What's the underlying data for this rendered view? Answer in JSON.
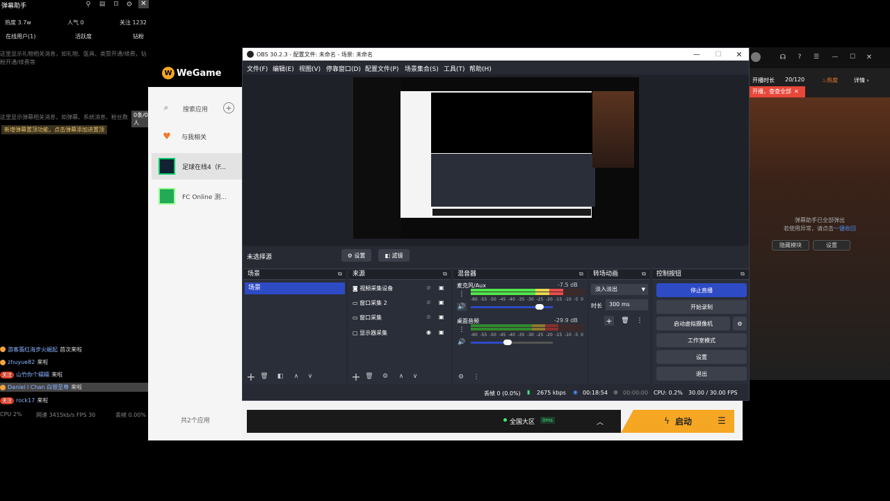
{
  "danmu": {
    "title": "弹幕助手",
    "stats": {
      "heat": "热度 3.7w",
      "popularity": "人气 0",
      "follow": "关注 1232"
    },
    "tabs": [
      "在线用户(1)",
      "活跃度",
      "钻粉"
    ],
    "hint1": "这里显示礼物相关消息，如礼物、医具、类赞开通/续费，钻粉开通/续费等",
    "hint2": "这里显示弹幕相关消息，如弹幕、系统消息、粉丝数",
    "badge": "0条/0人",
    "notice": "新增弹幕置顶功能，点击弹幕添加进置顶",
    "messages": [
      {
        "tag": "",
        "user": "游客翡红海步火崛起",
        "text": "首次来啦"
      },
      {
        "tag": "",
        "user": "zhuyue82",
        "text": "来啦"
      },
      {
        "tag": "关注",
        "user": "山竹你个糯糯",
        "text": "来啦"
      },
      {
        "tag": "",
        "user": "Daniel l Chan 白银至尊",
        "text": "来啦"
      },
      {
        "tag": "关注",
        "user": "rock17",
        "text": "来啦"
      }
    ],
    "footer": {
      "cpu": "CPU 2%",
      "net": "网速 3415kb/s  FPS 30",
      "loss": "丢帧 0.00%"
    }
  },
  "wegame": {
    "logo": "WeGame",
    "search_placeholder": "搜索应用",
    "items": [
      {
        "label": "与我相关"
      },
      {
        "label": "足球在线4（F..."
      },
      {
        "label": "FC Online 测..."
      }
    ],
    "app_count": "共2个应用",
    "region": "全国大区",
    "ping": "0ms",
    "start": "启动"
  },
  "obs": {
    "title": "OBS 30.2.3 - 配置文件: 未命名 - 场景: 未命名",
    "menu": [
      "文件(F)",
      "编辑(E)",
      "视图(V)",
      "停靠窗口(D)",
      "配置文件(P)",
      "场景集合(S)",
      "工具(T)",
      "帮助(H)"
    ],
    "no_source": "未选择源",
    "props_btn": "设置",
    "filters_btn": "滤镜",
    "scenes": {
      "title": "场景",
      "items": [
        "场景"
      ]
    },
    "sources": {
      "title": "来源",
      "items": [
        "视频采集设备",
        "窗口采集 2",
        "窗口采集",
        "显示器采集"
      ]
    },
    "mixer": {
      "title": "混音器",
      "channels": [
        {
          "name": "麦克风/Aux",
          "db": "-7.5 dB",
          "level": 0.82,
          "vol": 0.84
        },
        {
          "name": "桌面音频",
          "db": "-29.9 dB",
          "level": 0.78,
          "vol": 0.45
        }
      ],
      "scale": [
        "-60",
        "-55",
        "-50",
        "-45",
        "-40",
        "-35",
        "-30",
        "-25",
        "-20",
        "-15",
        "-10",
        "-5",
        "0"
      ]
    },
    "transitions": {
      "title": "转场动画",
      "type": "淡入淡出",
      "duration_label": "时长",
      "duration": "300 ms"
    },
    "controls": {
      "title": "控制按钮",
      "buttons": [
        "停止直播",
        "开始录制",
        "启动虚拟摄像机",
        "工作室模式",
        "设置",
        "退出"
      ]
    },
    "status": {
      "dropped": "丢帧 0 (0.0%)",
      "bitrate": "2675 kbps",
      "live_time": "00:18:54",
      "rec_time": "00:00:00",
      "cpu": "CPU: 0.2%",
      "fps": "30.00 / 30.00 FPS"
    }
  },
  "right_panel": {
    "live_time": "开播时长",
    "count": "20/120",
    "heat": "热度",
    "detail": "详情",
    "banner": "开播，查查全部",
    "msg1": "弹幕助手已全部弹出",
    "msg2": "若使用异常，请点击",
    "link": "一键收回",
    "btn1": "隐藏模块",
    "btn2": "设置"
  },
  "colors": {
    "accent": "#2e4bc6",
    "obs_bg": "#272a33",
    "orange": "#f5a623"
  }
}
